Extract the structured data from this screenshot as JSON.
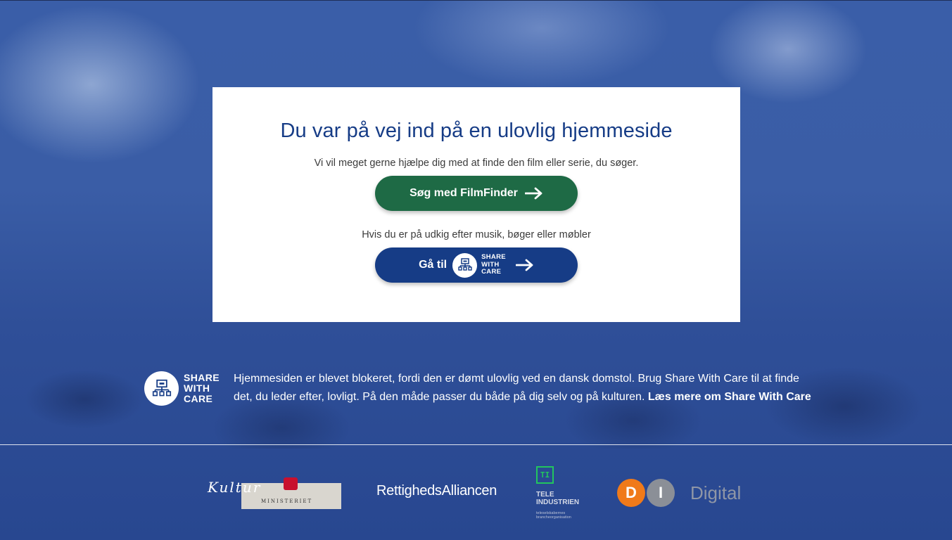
{
  "card": {
    "title": "Du var på vej ind på en ulovlig hjemmeside",
    "subtitle": "Vi vil meget gerne hjælpe dig med at finde den film eller serie, du søger.",
    "filmfinder_button": "Søg med FilmFinder",
    "secondary_text": "Hvis du er på udkig efter musik, bøger eller møbler",
    "share_button_prefix": "Gå til",
    "share_logo_lines": [
      "SHARE",
      "WITH",
      "CARE"
    ]
  },
  "info": {
    "logo_lines": [
      "SHARE",
      "WITH",
      "CARE"
    ],
    "text": "Hjemmesiden er blevet blokeret, fordi den er dømt ulovlig ved en dansk domstol. Brug Share With Care til at finde det, du leder efter, lovligt. På den måde passer du både på dig selv og på kulturen.",
    "link": "Læs mere om Share With Care"
  },
  "footer": {
    "kultur_script": "Kultur",
    "kultur_sub": "MINISTERIET",
    "rettigheds": "RettighedsAlliancen",
    "tele_box": "TI",
    "tele_name_lines": [
      "TELE",
      "INDUSTRIEN"
    ],
    "tele_sub_lines": [
      "teleselskabernes",
      "brancheorganisation"
    ],
    "di_d": "D",
    "di_i": "I",
    "di_text": "Digital"
  },
  "colors": {
    "title_blue": "#163c86",
    "green_button": "#1e6a45",
    "blue_button": "#163c86",
    "di_orange": "#f07a1a",
    "tele_green": "#22c55e"
  },
  "icons": [
    "arrow-right-icon",
    "share-with-care-icon",
    "crown-icon"
  ]
}
